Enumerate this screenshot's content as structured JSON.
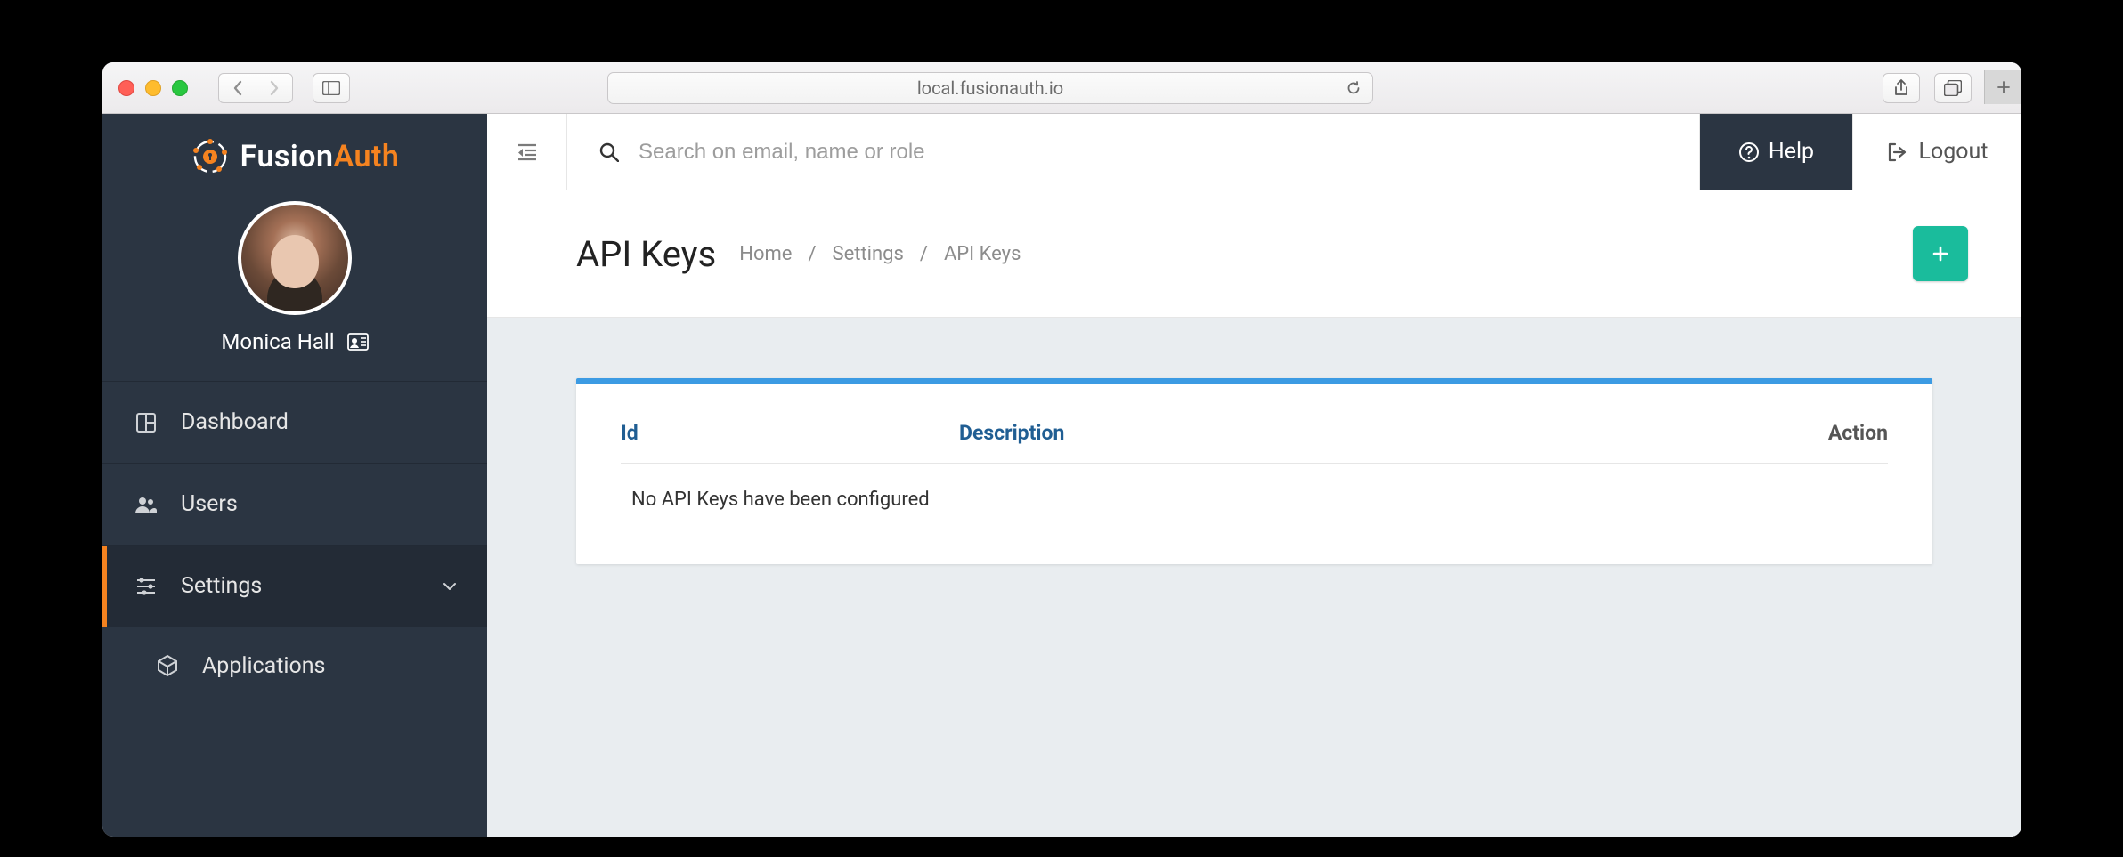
{
  "browser": {
    "address": "local.fusionauth.io"
  },
  "app": {
    "brand": {
      "word1": "Fusion",
      "word2": "Auth"
    },
    "user": {
      "display_name": "Monica Hall"
    },
    "sidebar": {
      "items": [
        {
          "label": "Dashboard",
          "icon": "dashboard-icon"
        },
        {
          "label": "Users",
          "icon": "users-icon"
        },
        {
          "label": "Settings",
          "icon": "sliders-icon",
          "active": true,
          "expanded": true
        },
        {
          "label": "Applications",
          "icon": "cube-icon",
          "sub": true
        }
      ]
    },
    "topbar": {
      "search_placeholder": "Search on email, name or role",
      "help_label": "Help",
      "logout_label": "Logout"
    },
    "page": {
      "title": "API Keys",
      "breadcrumb": [
        "Home",
        "Settings",
        "API Keys"
      ]
    },
    "table": {
      "columns": {
        "id": "Id",
        "description": "Description",
        "action": "Action"
      },
      "empty_message": "No API Keys have been configured",
      "rows": []
    }
  }
}
